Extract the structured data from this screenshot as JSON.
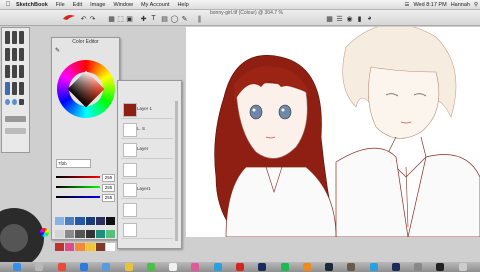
{
  "menubar": {
    "app_name": "SketchBook",
    "items": [
      "File",
      "Edit",
      "Image",
      "Window",
      "My Account",
      "Help"
    ],
    "clock": "Wed 8:17 PM",
    "user": "Hannah"
  },
  "toolbar": {
    "document_title": "bonny-girl.tif (Colour) @ 304.7 %"
  },
  "color_editor": {
    "title": "Color Editor",
    "hex_value": "7f2b",
    "values": [
      "255",
      "255",
      "255"
    ],
    "swatch_colors": [
      "#87b4e8",
      "#4a7fc4",
      "#2457a6",
      "#1a3d7a",
      "#2e2e5e",
      "#111111",
      "#d4d4d4",
      "#8a8a8a",
      "#555555",
      "#333333",
      "#1e8f7a",
      "#57c07a",
      "#c03030",
      "#e04a8a",
      "#f28a3a",
      "#f2c53a",
      "#7a3b2a",
      "#ffffff"
    ]
  },
  "layers": {
    "names": [
      "Layer 1",
      "L. S",
      "Layer",
      "",
      "Layer1",
      "",
      ""
    ]
  },
  "dock": {
    "apps": [
      "finder",
      "launchpad",
      "chrome",
      "safari",
      "mail",
      "photos",
      "messages",
      "calendar",
      "itunes",
      "skype",
      "sketchbook",
      "photoshop",
      "spotify",
      "vlc",
      "steam",
      "gimp",
      "skype2",
      "photoshop2",
      "system",
      "terminal",
      "trash"
    ]
  },
  "colors": {
    "hair_red": "#8e1f12",
    "hair_light": "#f4e6d6",
    "line_red": "#8a2a1e"
  }
}
